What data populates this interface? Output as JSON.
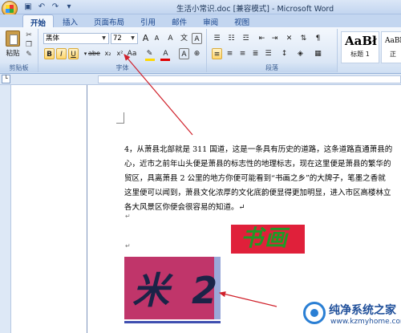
{
  "window": {
    "title": "生活小常识.doc [兼容模式] - Microsoft Word"
  },
  "qat": {
    "save_icon": "save-icon",
    "undo_icon": "undo-icon",
    "redo_icon": "redo-icon"
  },
  "tabs": [
    {
      "label": "开始",
      "active": true
    },
    {
      "label": "插入"
    },
    {
      "label": "页面布局"
    },
    {
      "label": "引用"
    },
    {
      "label": "邮件"
    },
    {
      "label": "审阅"
    },
    {
      "label": "视图"
    }
  ],
  "ribbon": {
    "clipboard": {
      "paste_label": "粘贴",
      "group_label": "剪贴板"
    },
    "font": {
      "font_name": "黑体",
      "font_size": "72",
      "group_label": "字体",
      "bold": "B",
      "italic": "I",
      "underline": "U",
      "strike": "abe",
      "subscript": "x₂",
      "superscript": "x²",
      "change_case": "Aa",
      "clear_format": "A",
      "grow": "A",
      "shrink": "A",
      "char_border": "A",
      "phonetic": "文"
    },
    "paragraph": {
      "group_label": "段落"
    },
    "styles": [
      {
        "preview": "AaBł",
        "name": "标题 1"
      },
      {
        "preview": "AaBbC",
        "name": "正"
      }
    ]
  },
  "document": {
    "lines": [
      "4，从萧县北部就是 311 国道，这是一条具有历史的道路，这条道路直通萧县的",
      "心，近市之前年山头便是萧县的标志性的地理标志，现在这里便是萧县的繁华的",
      "贸区，具离萧县 2 公里的地方你便可能看到“书画之乡”的大牌子，笔墨之香就",
      "这里便可以闻到，萧县文化浓厚的文化底韵便显得更加明显，进入市区高楼林立",
      "各大风景区你便会很容易的知道。↵"
    ],
    "shufa_text": "书画",
    "mi_text": "米 2"
  },
  "watermark": {
    "title": "纯净系统之家",
    "url": "www.kzmyhome.com"
  }
}
